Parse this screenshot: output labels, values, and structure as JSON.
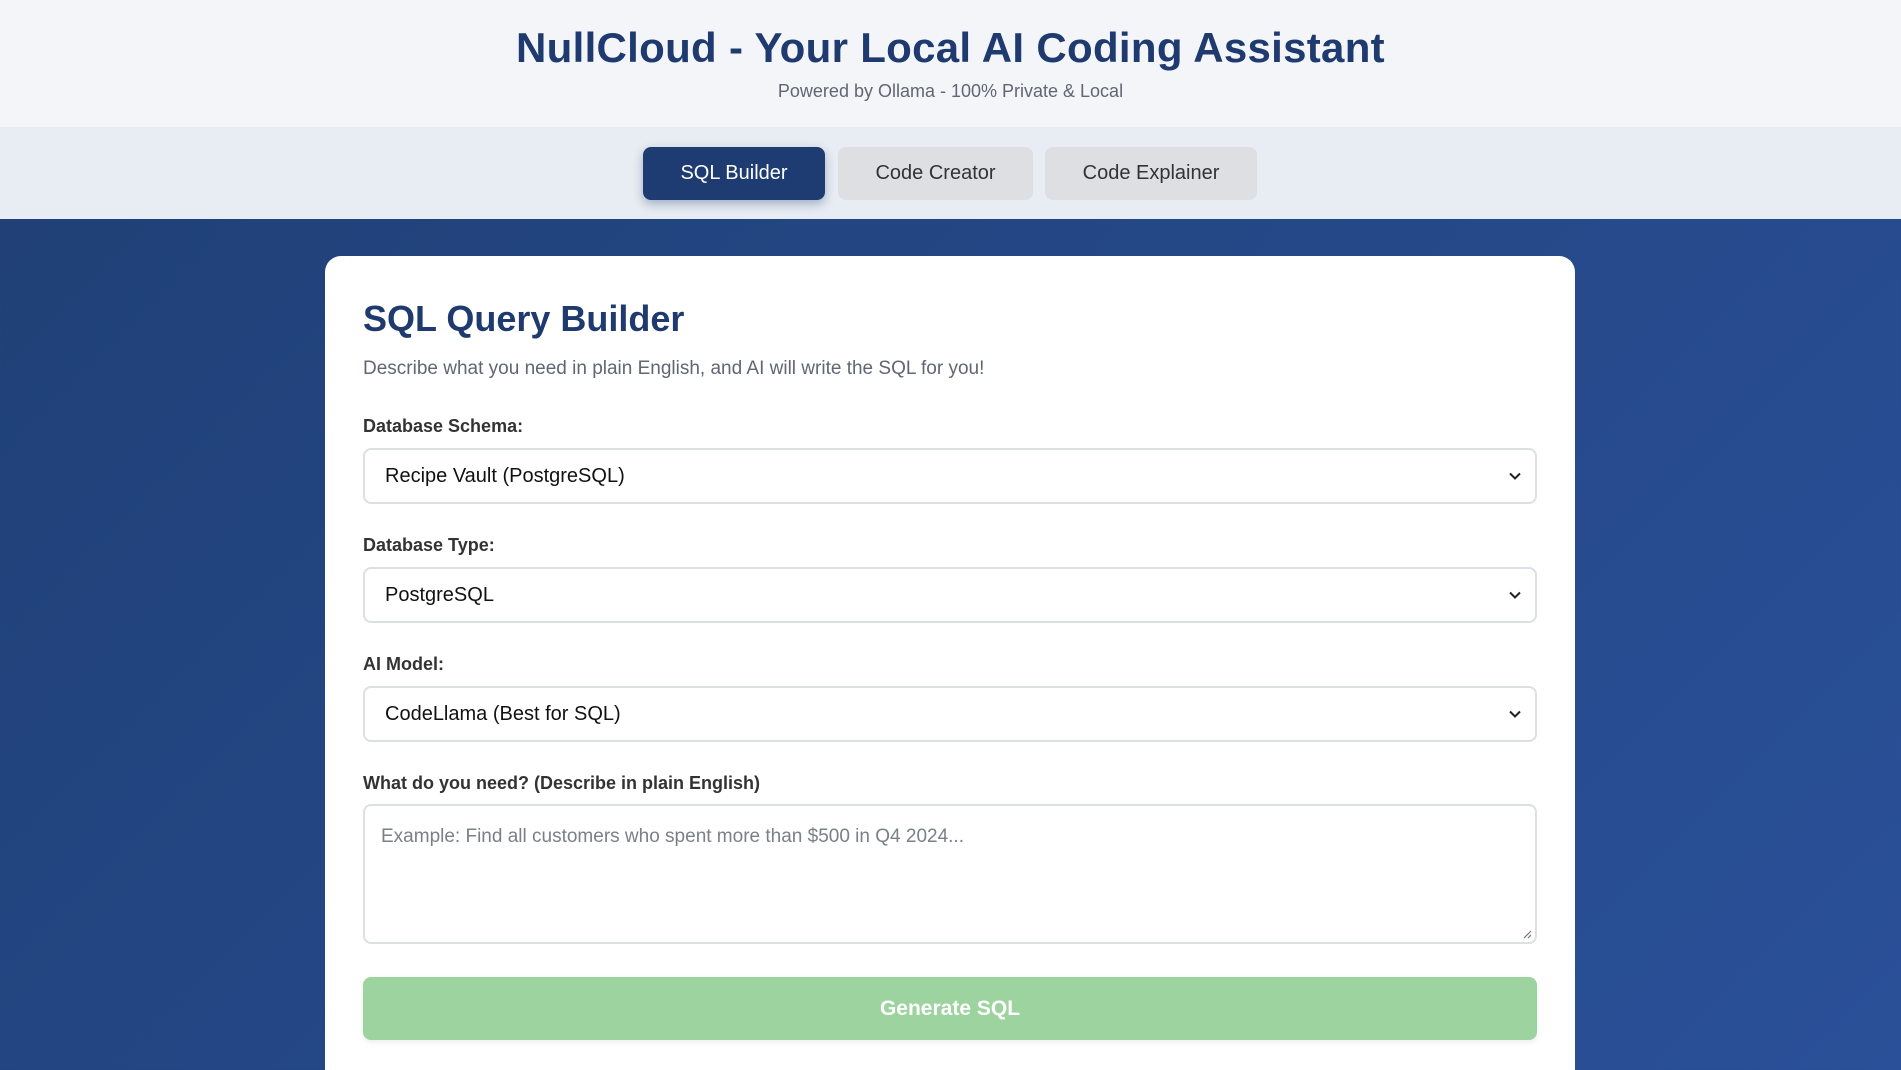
{
  "header": {
    "title": "NullCloud - Your Local AI Coding Assistant",
    "subtitle": "Powered by Ollama - 100% Private & Local"
  },
  "tabs": [
    {
      "label": "SQL Builder",
      "active": true
    },
    {
      "label": "Code Creator",
      "active": false
    },
    {
      "label": "Code Explainer",
      "active": false
    }
  ],
  "builder": {
    "title": "SQL Query Builder",
    "description": "Describe what you need in plain English, and AI will write the SQL for you!",
    "schema": {
      "label": "Database Schema:",
      "value": "Recipe Vault (PostgreSQL)"
    },
    "db_type": {
      "label": "Database Type:",
      "value": "PostgreSQL"
    },
    "model": {
      "label": "AI Model:",
      "value": "CodeLlama (Best for SQL)"
    },
    "request": {
      "label": "What do you need? (Describe in plain English)",
      "placeholder": "Example: Find all customers who spent more than $500 in Q4 2024..."
    },
    "generate_label": "Generate SQL"
  },
  "colors": {
    "brand_navy": "#1e3a6e",
    "generate_green": "#9dd39f",
    "background_blue": "#25498a"
  },
  "icons": {
    "dropdown": "chevron-down-icon",
    "resize": "resize-grip-icon"
  }
}
